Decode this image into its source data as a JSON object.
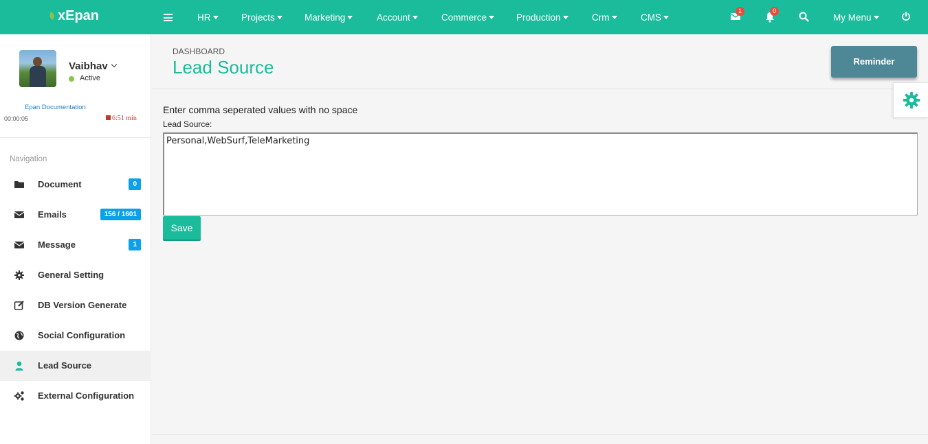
{
  "brand": {
    "name": "xEpan"
  },
  "topnav": {
    "items": [
      {
        "label": "HR"
      },
      {
        "label": "Projects"
      },
      {
        "label": "Marketing"
      },
      {
        "label": "Account"
      },
      {
        "label": "Commerce"
      },
      {
        "label": "Production"
      },
      {
        "label": "Crm"
      },
      {
        "label": "CMS"
      }
    ],
    "mail_count": "1",
    "notification_count": "0",
    "my_menu_label": "My Menu"
  },
  "user": {
    "name": "Vaibhav",
    "status": "Active",
    "doc_link": "Epan Documentation",
    "timer_elapsed": "00:00:05",
    "timer_remaining": "6:51 min"
  },
  "sidebar": {
    "heading": "Navigation",
    "items": [
      {
        "label": "Document",
        "icon": "folder-icon",
        "badge": "0"
      },
      {
        "label": "Emails",
        "icon": "envelope-icon",
        "badge": "156 / 1601"
      },
      {
        "label": "Message",
        "icon": "envelope-icon",
        "badge": "1"
      },
      {
        "label": "General Setting",
        "icon": "gear-icon"
      },
      {
        "label": "DB Version Generate",
        "icon": "edit-icon"
      },
      {
        "label": "Social Configuration",
        "icon": "globe-icon"
      },
      {
        "label": "Lead Source",
        "icon": "user-icon",
        "active": true
      },
      {
        "label": "External Configuration",
        "icon": "gears-icon"
      }
    ]
  },
  "page": {
    "breadcrumb": "DASHBOARD",
    "title": "Lead Source",
    "reminder_label": "Reminder",
    "help_text": "Enter comma seperated values with no space",
    "field_label": "Lead Source:",
    "field_value": "Personal,WebSurf,TeleMarketing",
    "save_label": "Save"
  },
  "colors": {
    "accent": "#1abc9c",
    "badge_blue": "#0aa1e8",
    "badge_red": "#e74c3c",
    "reminder": "#4e8796"
  }
}
